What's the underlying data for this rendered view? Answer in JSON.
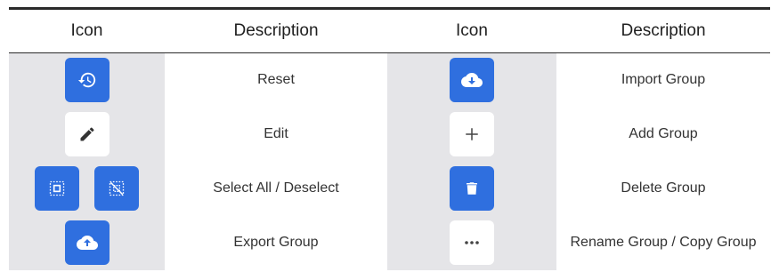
{
  "headers": [
    "Icon",
    "Description",
    "Icon",
    "Description"
  ],
  "rows": [
    {
      "left_desc": "Reset",
      "right_desc": "Import Group"
    },
    {
      "left_desc": "Edit",
      "right_desc": "Add Group"
    },
    {
      "left_desc": "Select All / Deselect",
      "right_desc": "Delete Group"
    },
    {
      "left_desc": "Export Group",
      "right_desc": "Rename Group / Copy Group"
    }
  ],
  "icons": {
    "reset": "history-icon",
    "edit": "pencil-icon",
    "select_all": "select-all-icon",
    "deselect": "deselect-icon",
    "export": "cloud-upload-icon",
    "import": "cloud-download-icon",
    "add": "plus-icon",
    "delete": "trash-icon",
    "rename_copy": "more-horizontal-icon"
  },
  "colors": {
    "accent": "#2f6fdf",
    "icon_cell_bg": "#e5e5e8"
  }
}
